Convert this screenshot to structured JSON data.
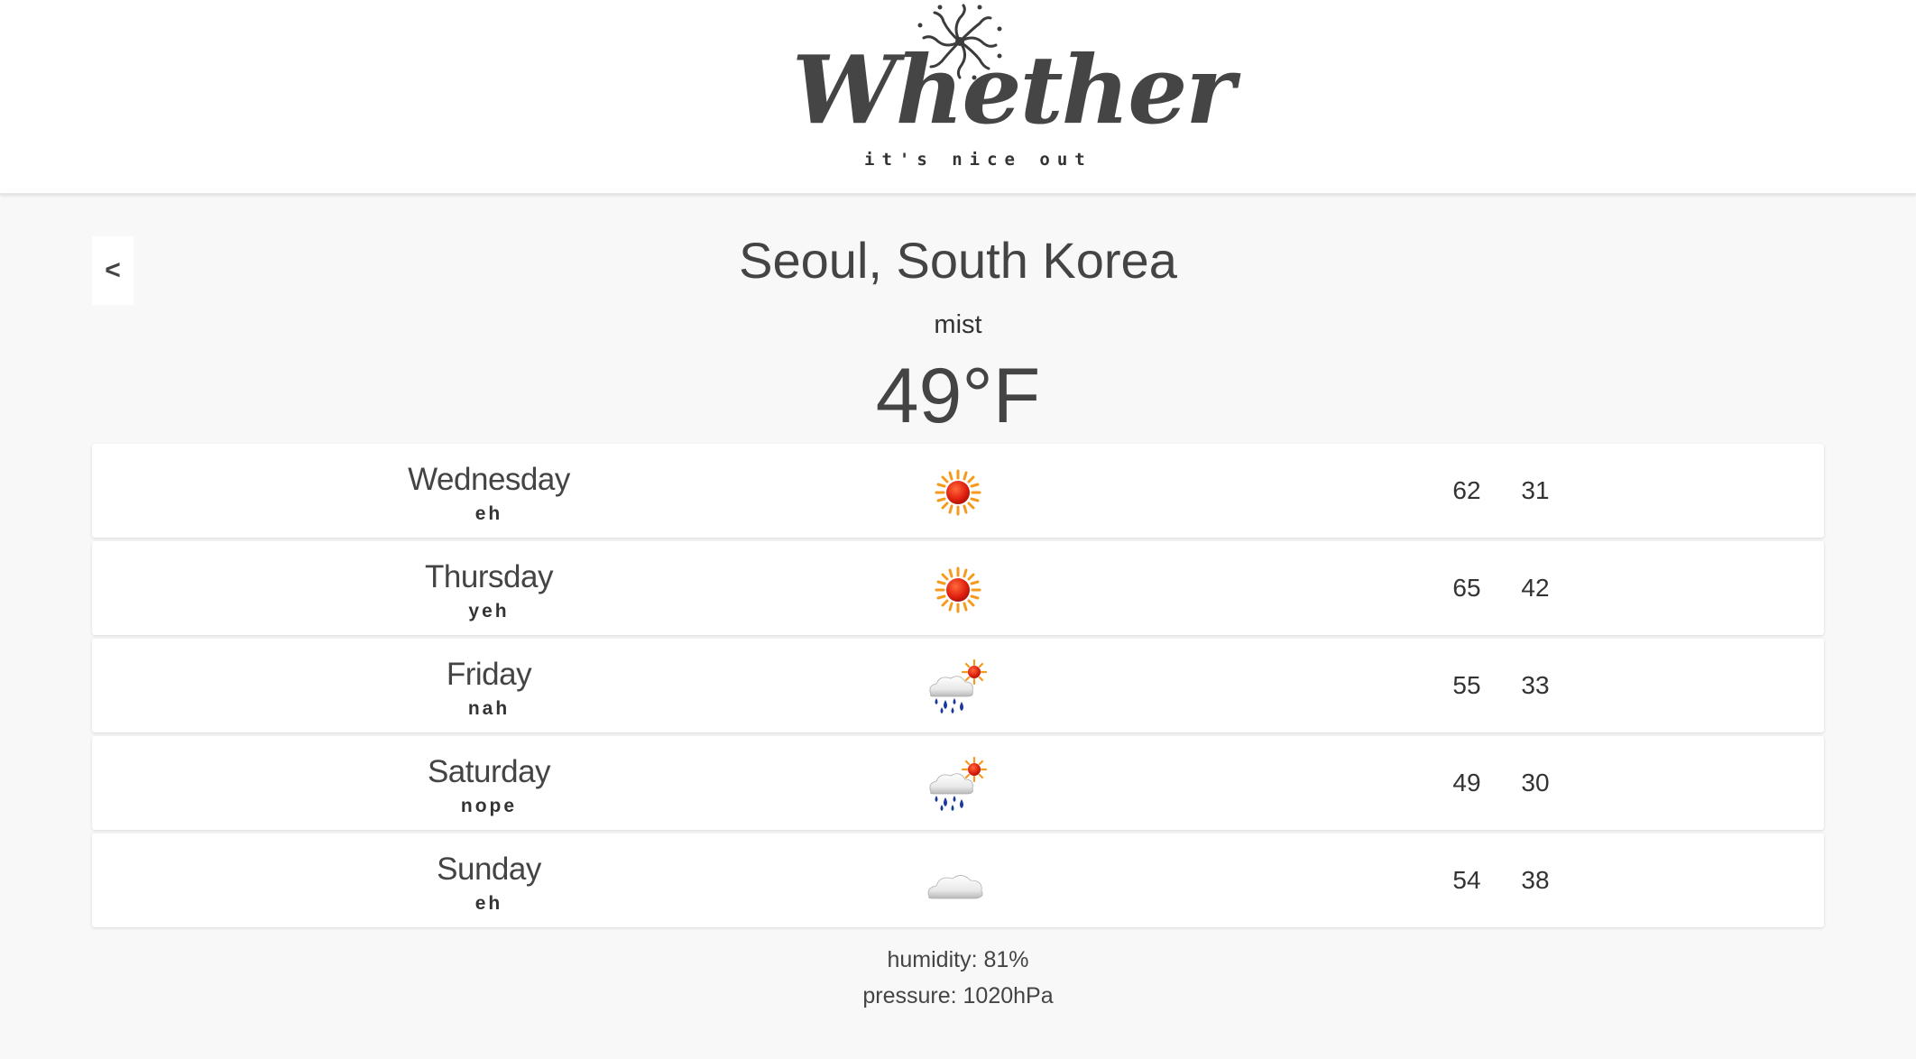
{
  "header": {
    "logo_word": "Whether",
    "tagline": "it's nice out"
  },
  "location": {
    "back_label": "<",
    "city": "Seoul, South Korea",
    "condition": "mist",
    "temperature": "49°F"
  },
  "forecast": [
    {
      "day": "Wednesday",
      "verdict": "eh",
      "icon": "sun-icon",
      "high": "62",
      "low": "31"
    },
    {
      "day": "Thursday",
      "verdict": "yeh",
      "icon": "sun-icon",
      "high": "65",
      "low": "42"
    },
    {
      "day": "Friday",
      "verdict": "nah",
      "icon": "rain-sun-icon",
      "high": "55",
      "low": "33"
    },
    {
      "day": "Saturday",
      "verdict": "nope",
      "icon": "rain-sun-icon",
      "high": "49",
      "low": "30"
    },
    {
      "day": "Sunday",
      "verdict": "eh",
      "icon": "cloud-icon",
      "high": "54",
      "low": "38"
    }
  ],
  "details": {
    "humidity": "humidity: 81%",
    "pressure": "pressure: 1020hPa"
  },
  "colors": {
    "background": "#f8f8f8",
    "card": "#ffffff",
    "text": "#444444",
    "sun": "#e8301a",
    "sun_rays": "#f59a1c",
    "rain": "#1a3a9a"
  }
}
